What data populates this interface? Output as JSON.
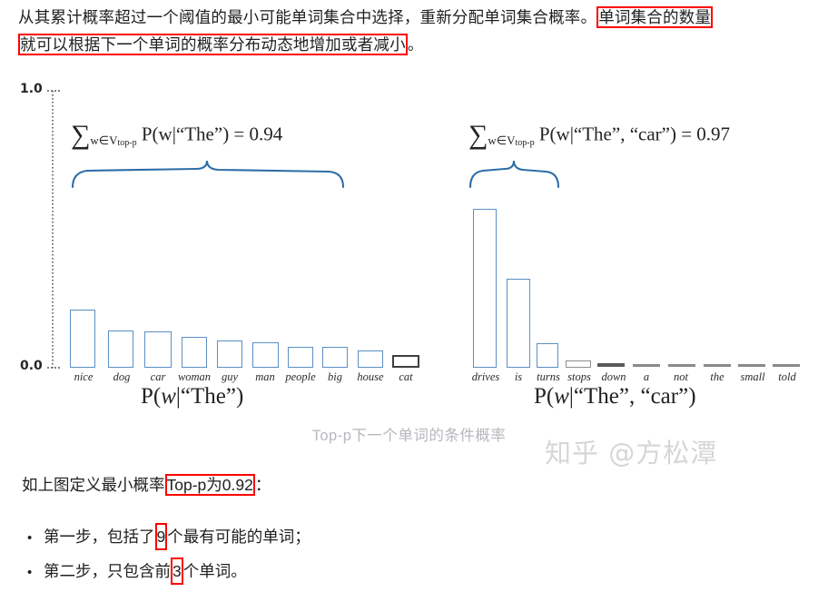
{
  "top_paragraph": {
    "part1": "从其累计概率超过一个阈值的最小可能单词集合中选择，重新分配单词集合概率。",
    "highlight1": "单词集合的数量",
    "highlight2": "就可以根据下一个单词的概率分布动态地增加或者减小",
    "tail": "。"
  },
  "figure": {
    "caption": "Top-p下一个单词的条件概率",
    "watermark": "知乎 @方松潭",
    "y_axis": {
      "top_label": "1.0",
      "bottom_label": "0.0"
    },
    "left_chart": {
      "formula_sigma": "∑",
      "formula_sub": "w∈V",
      "formula_subsub": "top-p",
      "formula_body": "P(w|“The”) = 0.94",
      "xlabel_prefix": "P(",
      "xlabel_w": "w",
      "xlabel_suffix": "|“The”)"
    },
    "right_chart": {
      "formula_sigma": "∑",
      "formula_sub": "w∈V",
      "formula_subsub": "top-p",
      "formula_body": "P(w|“The”, “car”) = 0.97",
      "xlabel_prefix": "P(",
      "xlabel_w": "w",
      "xlabel_suffix": "|“The”, “car”)"
    }
  },
  "chart_data": [
    {
      "type": "bar",
      "title": "P(w|\"The\")",
      "annotation": "∑ w∈V_top-p  P(w|\"The\") = 0.94",
      "categories": [
        "nice",
        "dog",
        "car",
        "woman",
        "guy",
        "man",
        "people",
        "big",
        "house",
        "cat"
      ],
      "values": [
        0.21,
        0.135,
        0.13,
        0.112,
        0.1,
        0.093,
        0.078,
        0.077,
        0.062,
        0.045
      ],
      "colors": [
        "#5b8fc4",
        "#5b8fc4",
        "#5b8fc4",
        "#5b8fc4",
        "#5b8fc4",
        "#5b8fc4",
        "#5b8fc4",
        "#5b8fc4",
        "#5b8fc4",
        "#3f3f3f"
      ],
      "brace_covers": [
        "nice",
        "dog",
        "car",
        "woman",
        "guy",
        "man",
        "people",
        "big",
        "house"
      ],
      "xlabel": "P(w|\"The\")",
      "ylabel": "",
      "ylim": [
        0.0,
        1.0
      ],
      "grid": false,
      "legend": "none"
    },
    {
      "type": "bar",
      "title": "P(w|\"The\", \"car\")",
      "annotation": "∑ w∈V_top-p  P(w|\"The\", \"car\") = 0.97",
      "categories": [
        "drives",
        "is",
        "turns",
        "stops",
        "down",
        "a",
        "not",
        "the",
        "small",
        "told"
      ],
      "values": [
        0.57,
        0.325,
        0.095,
        0.022,
        0.012,
        0.008,
        0.008,
        0.007,
        0.007,
        0.007
      ],
      "colors": [
        "#5b8fc4",
        "#5b8fc4",
        "#5b8fc4",
        "#8d8d8d",
        "#6b6b6b",
        "#6b6b6b",
        "#6b6b6b",
        "#6b6b6b",
        "#6b6b6b",
        "#6b6b6b"
      ],
      "brace_covers": [
        "drives",
        "is",
        "turns"
      ],
      "xlabel": "P(w|\"The\", \"car\")",
      "ylabel": "",
      "ylim": [
        0.0,
        1.0
      ],
      "grid": false,
      "legend": "none"
    }
  ],
  "define_line": {
    "prefix": "如上图定义最小概率",
    "highlight": "Top-p为0.92",
    "suffix": "："
  },
  "bullets": [
    {
      "dot": "•",
      "prefix": "第一步，包括了",
      "highlight": "9",
      "suffix": "个最有可能的单词；"
    },
    {
      "dot": "•",
      "prefix": "第二步，只包含前",
      "highlight": "3",
      "suffix": "个单词。"
    }
  ]
}
